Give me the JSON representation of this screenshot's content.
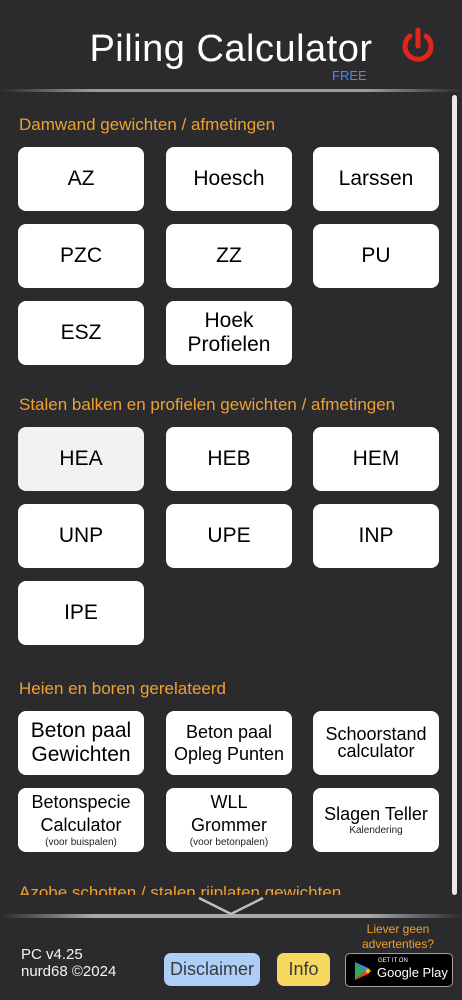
{
  "header": {
    "title": "Piling Calculator",
    "badge": "FREE",
    "power_icon": "power-icon"
  },
  "sections": [
    {
      "title": "Damwand gewichten / afmetingen",
      "buttons": [
        "AZ",
        "Hoesch",
        "Larssen",
        "PZC",
        "ZZ",
        "PU",
        "ESZ",
        "Hoek Profielen"
      ]
    },
    {
      "title": "Stalen balken en profielen gewichten / afmetingen",
      "buttons": [
        "HEA",
        "HEB",
        "HEM",
        "UNP",
        "UPE",
        "INP",
        "IPE"
      ]
    },
    {
      "title": "Heien en boren gerelateerd",
      "buttons": [
        {
          "main": "Beton paal Gewichten"
        },
        {
          "main": "Beton paal Opleg Punten"
        },
        {
          "main": "Schoorstand calculator"
        },
        {
          "main": "Betonspecie Calculator",
          "sub": "(voor buispalen)"
        },
        {
          "main": "WLL Grommer",
          "sub": "(voor betonpalen)"
        },
        {
          "main": "Slagen Teller",
          "sub": "Kalendering"
        }
      ]
    },
    {
      "title": "Azobe schotten / stalen rijplaten gewichten"
    }
  ],
  "footer": {
    "version": "PC v4.25",
    "copyright": "nurd68 ©2024",
    "disclaimer_label": "Disclaimer",
    "info_label": "Info",
    "no_ads_line1": "Liever geen",
    "no_ads_line2": "advertenties?",
    "gplay_small": "GET IT ON",
    "gplay_label": "Google Play"
  },
  "colors": {
    "background": "#2b2b2e",
    "section_title": "#f0a030",
    "free": "#3f8bff",
    "power": "#e0261c"
  }
}
